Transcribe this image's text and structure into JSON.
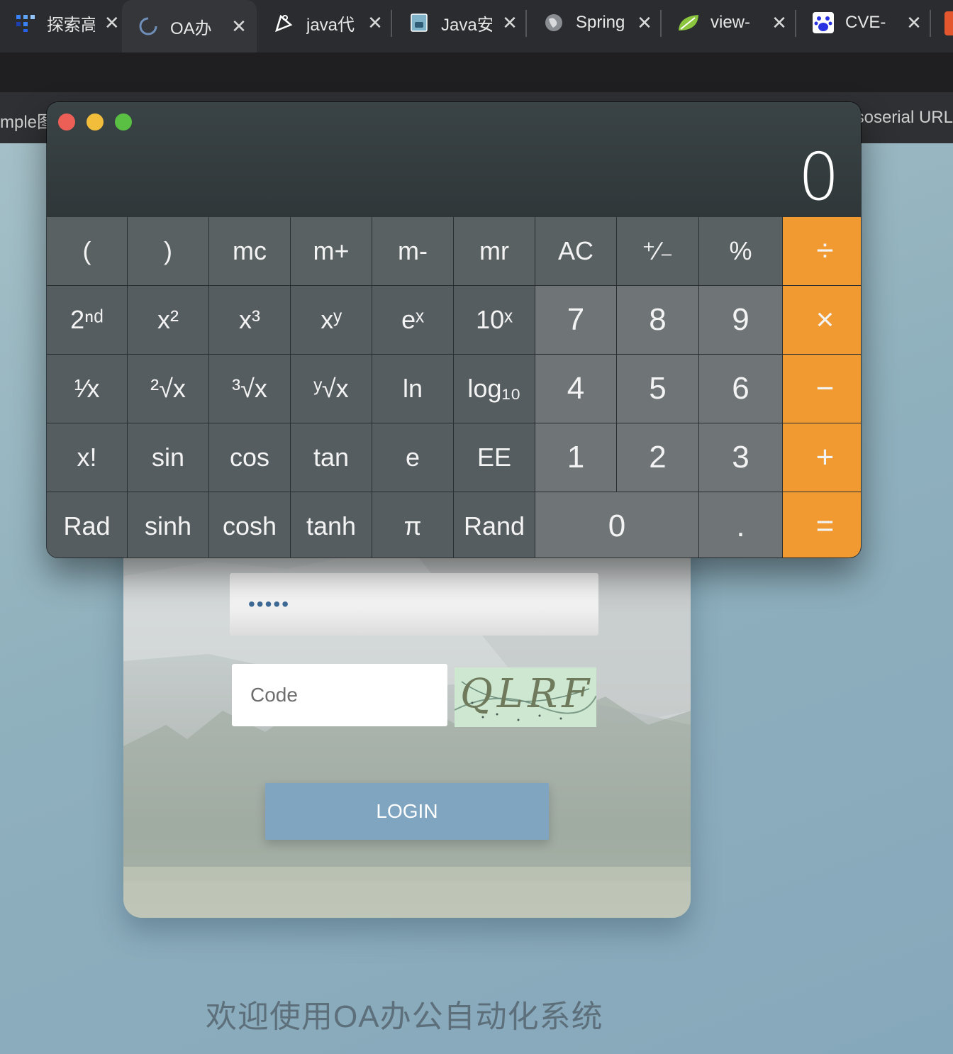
{
  "browser": {
    "tabs": [
      {
        "title": "探索高",
        "icon": "grid-logo-icon"
      },
      {
        "title": "OA办",
        "icon": "loading-spinner-icon"
      },
      {
        "title": "java代",
        "icon": "pen-logo-icon"
      },
      {
        "title": "Java安",
        "icon": "coffee-book-icon"
      },
      {
        "title": "Spring",
        "icon": "globe-icon"
      },
      {
        "title": "view-",
        "icon": "leaf-icon"
      },
      {
        "title": "CVE-",
        "icon": "baidu-paw-icon"
      }
    ],
    "close_glyph": "✕",
    "bookmarks": {
      "left": "mple图",
      "right": "soserial URL"
    }
  },
  "calculator": {
    "display": "0",
    "rows": [
      [
        "(",
        ")",
        "mc",
        "m+",
        "m-",
        "mr",
        "AC",
        "⁺∕₋",
        "%",
        "÷"
      ],
      [
        "2ⁿᵈ",
        "x²",
        "x³",
        "xʸ",
        "eˣ",
        "10ˣ",
        "7",
        "8",
        "9",
        "×"
      ],
      [
        "¹∕x",
        "²√x",
        "³√x",
        "ʸ√x",
        "ln",
        "log₁₀",
        "4",
        "5",
        "6",
        "−"
      ],
      [
        "x!",
        "sin",
        "cos",
        "tan",
        "e",
        "EE",
        "1",
        "2",
        "3",
        "+"
      ],
      [
        "Rad",
        "sinh",
        "cosh",
        "tanh",
        "π",
        "Rand",
        "0",
        ".",
        "="
      ]
    ]
  },
  "login": {
    "password_value": "•••••",
    "code_placeholder": "Code",
    "captcha_text": "QLRF",
    "login_button": "LOGIN",
    "welcome": "欢迎使用OA办公自动化系统"
  },
  "colors": {
    "calc_operator": "#f09a31",
    "login_button": "#7fa5c1",
    "traffic_red": "#ec5f57",
    "traffic_yellow": "#f1bd3b",
    "traffic_green": "#5ac044"
  }
}
